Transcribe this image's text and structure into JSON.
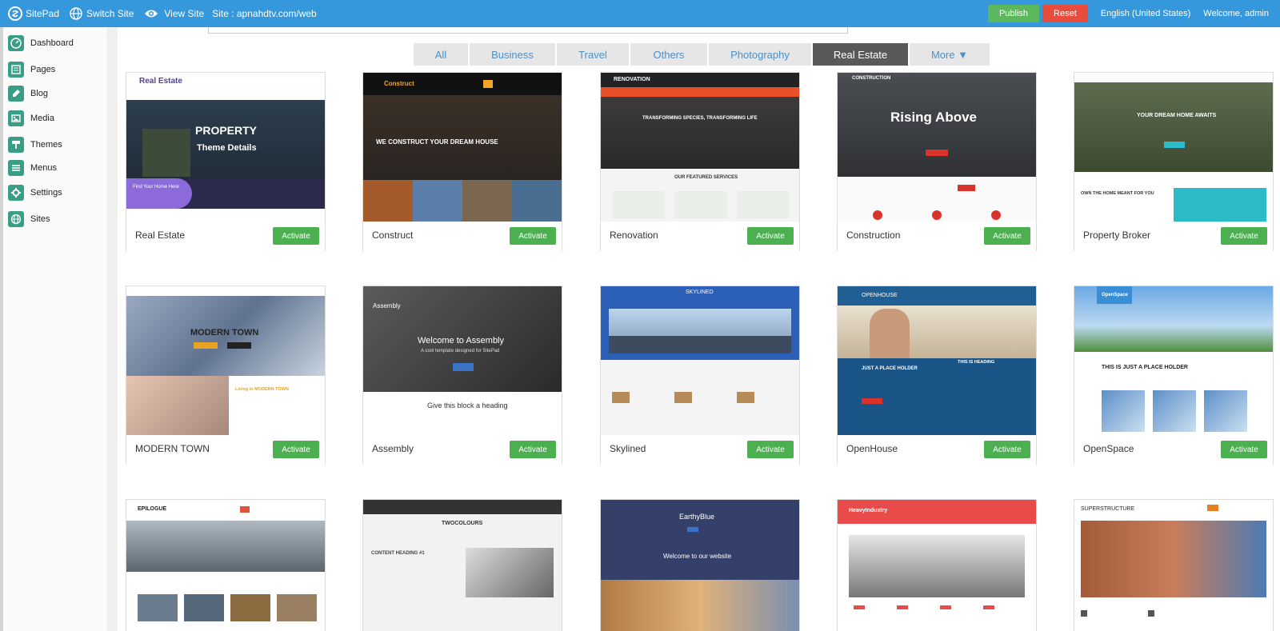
{
  "topbar": {
    "brand": "SitePad",
    "switch_site": "Switch Site",
    "view_site": "View Site",
    "site_url": "Site : apnahdtv.com/web",
    "publish": "Publish",
    "reset": "Reset",
    "language": "English (United States)",
    "welcome": "Welcome, admin",
    "colors": {
      "bar": "#3598dc",
      "publish": "#5cb85c",
      "reset": "#e74c3c"
    }
  },
  "sidebar": {
    "items": [
      {
        "label": "Dashboard",
        "icon": "dashboard-icon"
      },
      {
        "label": "Pages",
        "icon": "pages-icon"
      },
      {
        "label": "Blog",
        "icon": "blog-icon"
      },
      {
        "label": "Media",
        "icon": "media-icon"
      },
      {
        "label": "Themes",
        "icon": "themes-icon"
      },
      {
        "label": "Menus",
        "icon": "menus-icon"
      },
      {
        "label": "Settings",
        "icon": "settings-icon"
      },
      {
        "label": "Sites",
        "icon": "sites-icon"
      }
    ]
  },
  "tabs": [
    {
      "label": "All"
    },
    {
      "label": "Business"
    },
    {
      "label": "Travel"
    },
    {
      "label": "Others"
    },
    {
      "label": "Photography"
    },
    {
      "label": "Real Estate",
      "active": true
    },
    {
      "label": "More ▼"
    }
  ],
  "activate_label": "Activate",
  "themes": [
    {
      "name": "Real Estate",
      "thumb": {
        "heading": "PROPERTY",
        "sub": "Theme Details",
        "logo": "Real Estate",
        "cta": "Find Your Home Here"
      }
    },
    {
      "name": "Construct",
      "thumb": {
        "heading": "WE CONSTRUCT YOUR DREAM HOUSE",
        "logo": "Construct"
      }
    },
    {
      "name": "Renovation",
      "thumb": {
        "heading": "TRANSFORMING SPECIES, TRANSFORMING LIFE",
        "logo": "RENOVATION",
        "section": "OUR FEATURED SERVICES"
      }
    },
    {
      "name": "Construction",
      "thumb": {
        "heading": "Rising Above",
        "logo": "CONSTRUCTION"
      }
    },
    {
      "name": "Property Broker",
      "thumb": {
        "heading": "YOUR DREAM HOME AWAITS",
        "section": "OWN THE HOME MEANT FOR YOU"
      }
    },
    {
      "name": "MODERN TOWN",
      "thumb": {
        "heading": "MODERN TOWN",
        "section": "Living in MODERN TOWN"
      }
    },
    {
      "name": "Assembly",
      "thumb": {
        "heading": "Welcome to Assembly",
        "sub": "A cool template designed for SitePad",
        "section": "Give this block a heading",
        "logo": "Assembly"
      }
    },
    {
      "name": "Skylined",
      "thumb": {
        "logo": "SKYLINED"
      }
    },
    {
      "name": "OpenHouse",
      "thumb": {
        "logo": "OPENHOUSE",
        "section": "JUST A PLACE HOLDER",
        "sub": "THIS IS HEADING"
      }
    },
    {
      "name": "OpenSpace",
      "thumb": {
        "logo": "OpenSpace",
        "section": "THIS IS JUST A PLACE HOLDER"
      }
    },
    {
      "name": "",
      "thumb": {
        "logo": "EPILOGUE"
      }
    },
    {
      "name": "",
      "thumb": {
        "logo": "TWOCOLOURS",
        "section": "CONTENT HEADING #1"
      }
    },
    {
      "name": "",
      "thumb": {
        "logo": "EarthyBlue",
        "section": "Welcome to our website"
      }
    },
    {
      "name": "",
      "thumb": {
        "logo": "HeavyIndustry"
      }
    },
    {
      "name": "",
      "thumb": {
        "logo": "SUPERSTRUCTURE"
      }
    }
  ]
}
